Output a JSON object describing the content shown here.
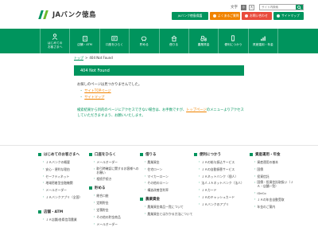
{
  "header": {
    "logo_text": "JAバンク徳島",
    "font_size_label": "文字",
    "font_sizes": [
      "小",
      "大"
    ],
    "search_placeholder": "サイト内検索",
    "buttons": [
      {
        "label": "JAバンク徳島保護"
      },
      {
        "label": "よくあるご質問"
      },
      {
        "label": "お問い合わせ"
      },
      {
        "label": "サイトマップ"
      }
    ]
  },
  "nav": [
    {
      "label": "はじめての\nお客さまへ"
    },
    {
      "label": "店舗・ATM"
    },
    {
      "label": "口座をひらく"
    },
    {
      "label": "貯める"
    },
    {
      "label": "借りる"
    },
    {
      "label": "農業資金"
    },
    {
      "label": "便利につかう"
    },
    {
      "label": "資産運用・年金"
    }
  ],
  "breadcrumb": {
    "home": "トップ",
    "sep": ">",
    "current": "404 Not Found"
  },
  "page_title": "404 Not Found",
  "message": "お探しのページは見つかりませんでした。",
  "links": [
    {
      "label": "サイトTOPページ"
    },
    {
      "label": "サイトマップ"
    }
  ],
  "note_before": "検索結果から目的のページにアクセスできない場合は、お手数ですが、",
  "note_link": "トップページ",
  "note_after": "のメニューよりアクセスしていただきますよう、お願いいたします。",
  "footer": {
    "col1": {
      "head": "はじめてのお客さまへ",
      "items": [
        "ＪＡバンクの概要",
        "安心・便利な理由",
        "セーフティネット",
        "地域密着型金融機関",
        "メールオーダー",
        "ＪＡバンクアプリ（全国）"
      ],
      "head2": "店舗・ATM",
      "items2": [
        "ＪＡ店舗/各県信用農業"
      ]
    },
    "col2": {
      "head": "口座をひらく",
      "items": [
        "メールオーダー",
        "取引時確認に関するお客様へのお願い",
        "相続手続き"
      ],
      "head2": "貯める",
      "items2": [
        "総合口座",
        "定期貯金",
        "定積貯金",
        "その他の貯金商品",
        "メールオーダー"
      ]
    },
    "col3": {
      "head": "借りる",
      "items": [
        "農業資金",
        "住宅ローン",
        "マイカーローン",
        "その他のローン",
        "構造改善型利率"
      ],
      "head2": "農業資金",
      "items2": [
        "農業資金商品一覧について",
        "農業資金とはかかる方法について"
      ]
    },
    "col4": {
      "head": "便利につかう",
      "items": [
        "ＪＡの給与振込サービス",
        "ＪＡの自動振替サービス",
        "ＪＡネットバンク（個人）",
        "法人ＪＡネットバンク（法人）",
        "ＪＡカード",
        "ＪＡのキャッシュカード",
        "ＪＡバンクのアプリ"
      ]
    },
    "col5": {
      "head": "資産運用・年金",
      "items": [
        "資産運用の基本",
        "国債",
        "投資信託",
        "国債・投資信託取扱い（ＪＡ・店舗一覧）",
        "iDeCo",
        "ＪＡの年金自動受取",
        "年金のご案内"
      ]
    }
  }
}
